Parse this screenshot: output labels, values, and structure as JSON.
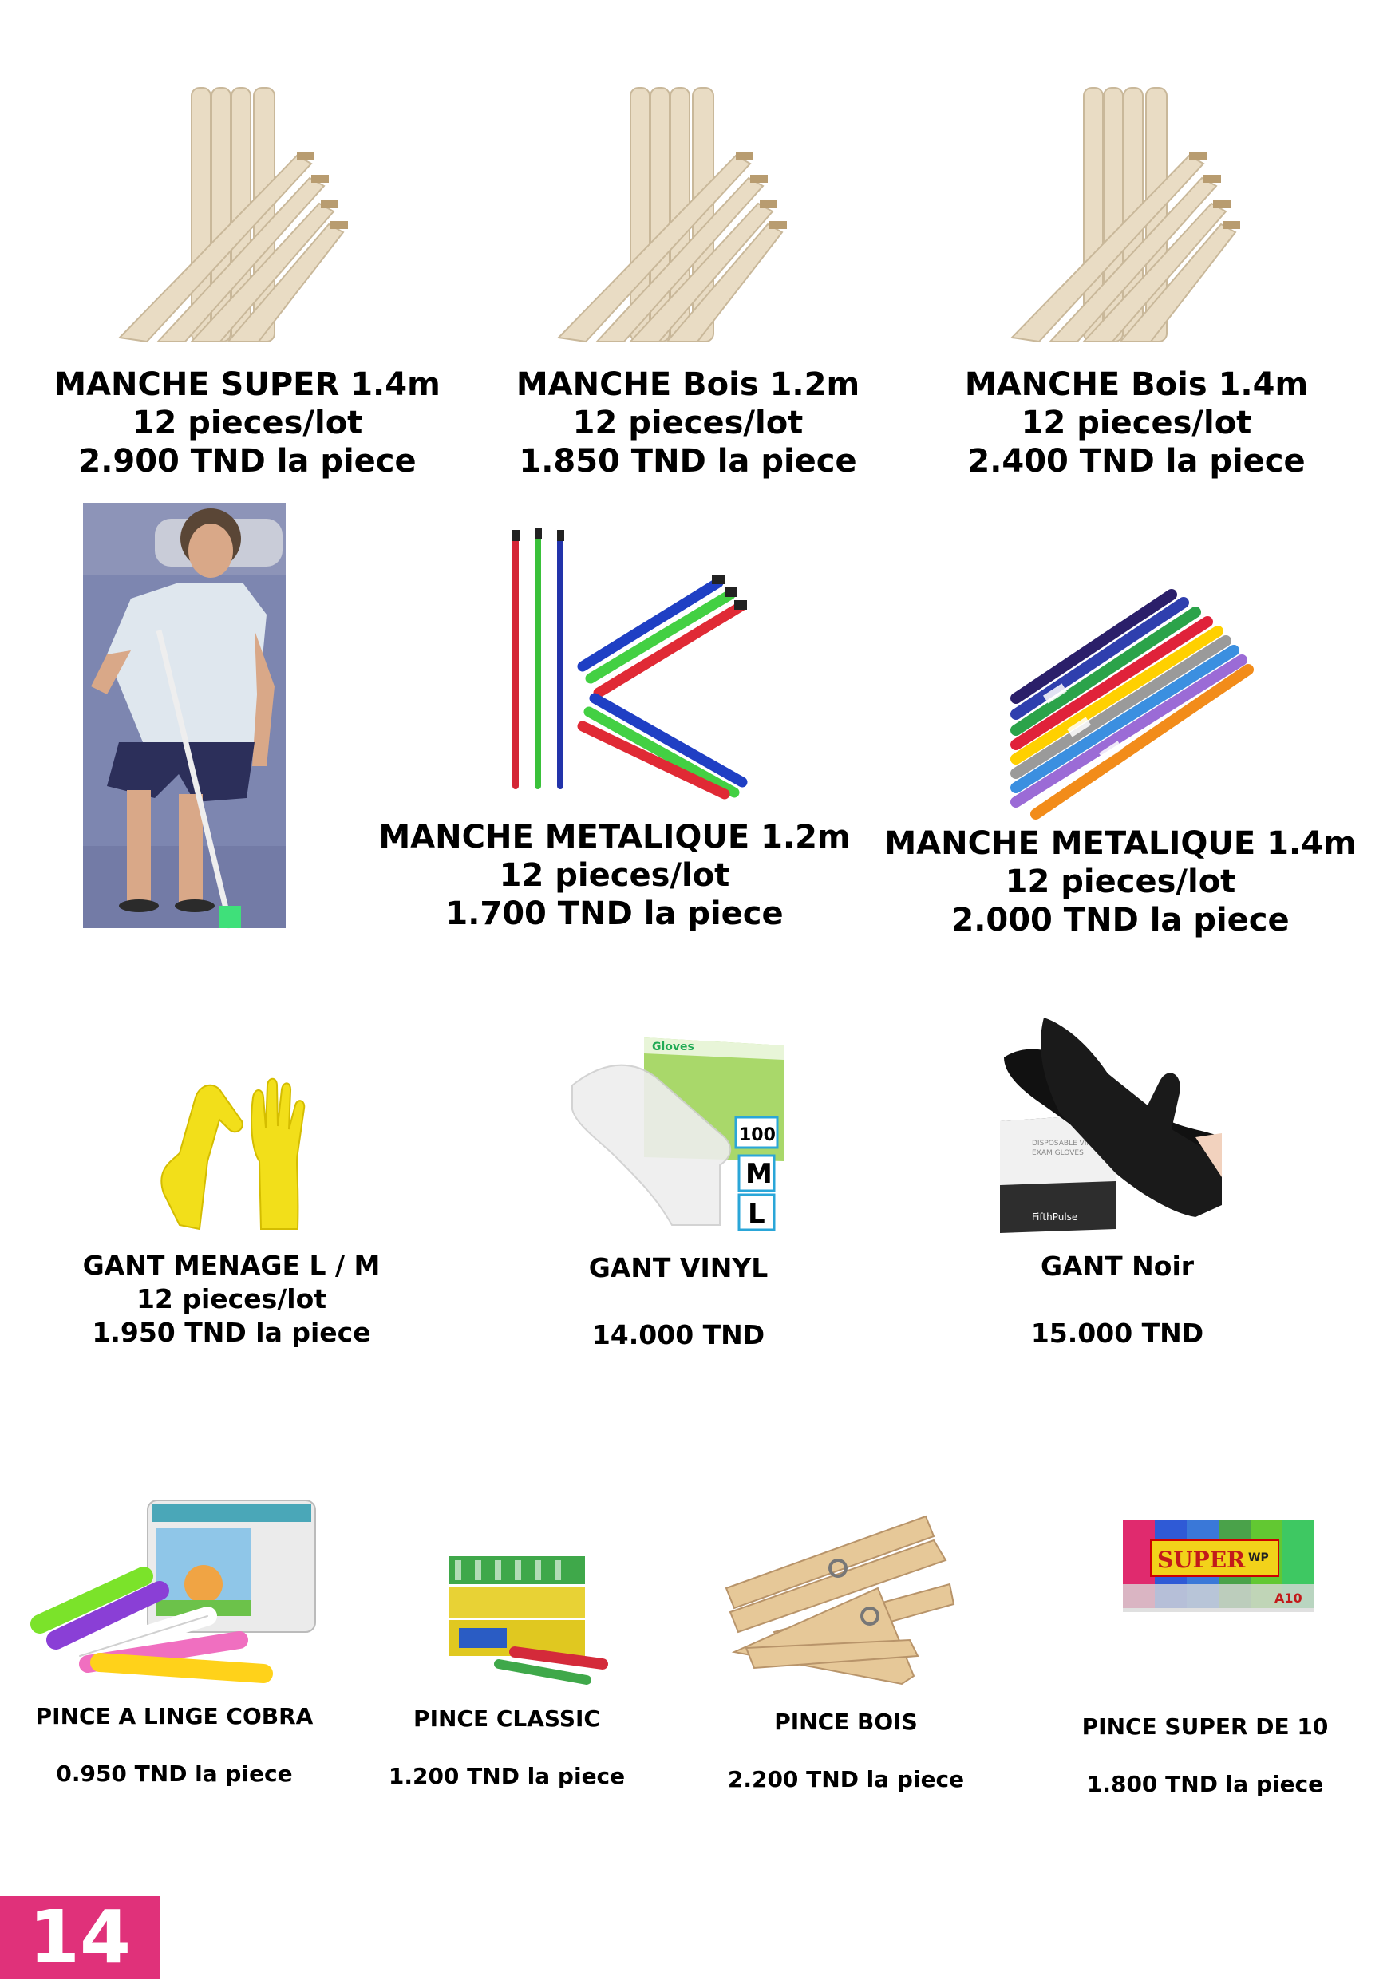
{
  "products": [
    {
      "name": "MANCHE SUPER 1.4m",
      "lot": "12 pieces/lot",
      "price": "2.900 TND la piece",
      "image": "wooden-handles"
    },
    {
      "name": "MANCHE Bois 1.2m",
      "lot": "12 pieces/lot",
      "price": "1.850 TND la piece",
      "image": "wooden-handles"
    },
    {
      "name": "MANCHE Bois 1.4m",
      "lot": "12 pieces/lot",
      "price": "2.400 TND la piece",
      "image": "wooden-handles"
    },
    {
      "name": "MANCHE METALIQUE 1.2m",
      "lot": "12 pieces/lot",
      "price": "1.700 TND la piece",
      "image": "metal-handles"
    },
    {
      "name": "MANCHE METALIQUE 1.4m",
      "lot": "12 pieces/lot",
      "price": "2.000 TND la piece",
      "image": "metal-handles-bundle"
    },
    {
      "name": "GANT MENAGE L / M",
      "lot": "12 pieces/lot",
      "price": "1.950 TND la piece",
      "image": "yellow-rubber-gloves"
    },
    {
      "name": "GANT  VINYL",
      "price": "14.000 TND",
      "image": "vinyl-gloves-box"
    },
    {
      "name": "GANT Noir",
      "price": "15.000 TND",
      "image": "black-gloves-box"
    },
    {
      "name": "PINCE A LINGE COBRA",
      "price": "0.950 TND la piece",
      "image": "cobra-clothespins"
    },
    {
      "name": "PINCE CLASSIC",
      "price": "1.200 TND la piece",
      "image": "plastic-clothespins"
    },
    {
      "name": "PINCE BOIS",
      "price": "2.200 TND la piece",
      "image": "wooden-clothespins"
    },
    {
      "name": "PINCE SUPER DE 10",
      "price": "1.800 TND la piece",
      "image": "super-clothespins-pack"
    }
  ],
  "photo": {
    "image": "person-with-mop-photo"
  },
  "vinyl_box": {
    "brand": "Gloves",
    "count": "100",
    "sizes": [
      "M",
      "L"
    ]
  },
  "black_box": {
    "line1": "DISPOSABLE VINYL",
    "line2": "EXAM GLOVES",
    "brand": "FifthPulse"
  },
  "super_pack": {
    "brand": "SUPER",
    "tag": "WP",
    "count": "A10"
  },
  "page_number": "14",
  "colors": {
    "page_badge": "#e0317a",
    "wood": "#e6d8c0",
    "yellow": "#f2df1a"
  }
}
